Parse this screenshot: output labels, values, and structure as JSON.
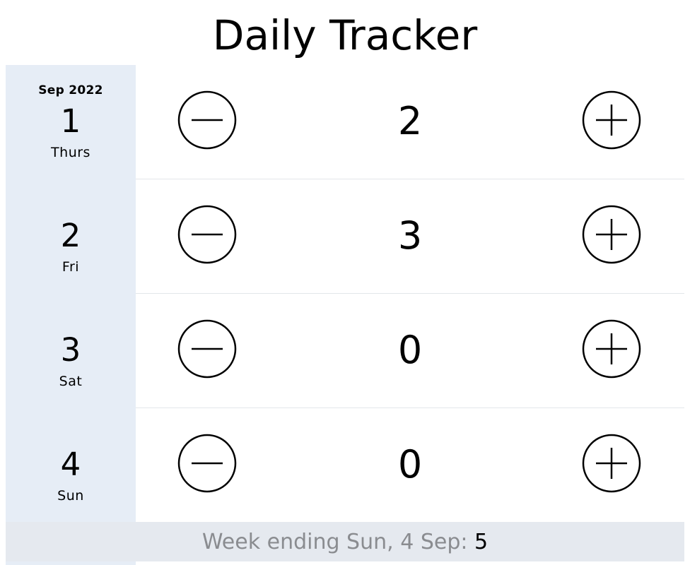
{
  "app": {
    "title": "Daily Tracker"
  },
  "colors": {
    "date_column_bg": "#e6edf6",
    "footer_bg": "#e5e9ef",
    "footer_text": "#8a8c90",
    "divider": "#e3e6ea"
  },
  "entries": [
    {
      "month": "Sep 2022",
      "day": "1",
      "weekday": "Thurs",
      "count": "2"
    },
    {
      "month": "",
      "day": "2",
      "weekday": "Fri",
      "count": "3"
    },
    {
      "month": "",
      "day": "3",
      "weekday": "Sat",
      "count": "0"
    },
    {
      "month": "",
      "day": "4",
      "weekday": "Sun",
      "count": "0"
    }
  ],
  "footer": {
    "label": "Week ending Sun, 4 Sep: ",
    "total": "5"
  },
  "icons": {
    "decrement": "minus-circle-icon",
    "increment": "plus-circle-icon"
  }
}
